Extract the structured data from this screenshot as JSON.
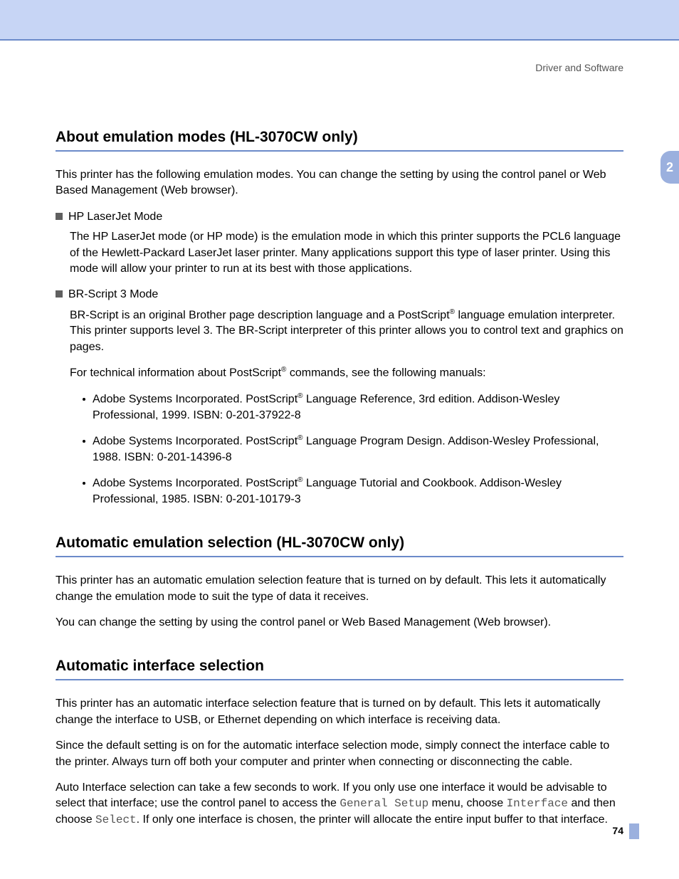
{
  "header": {
    "right_text": "Driver and Software"
  },
  "chapter_tab": "2",
  "page_number": "74",
  "section1": {
    "title": "About emulation modes (HL-3070CW only)",
    "sub": "2",
    "intro": "This printer has the following emulation modes. You can change the setting by using the control panel or Web Based Management (Web browser).",
    "mode1_title": "HP LaserJet Mode",
    "mode1_body": "The HP LaserJet mode (or HP mode) is the emulation mode in which this printer supports the PCL6 language of the Hewlett-Packard LaserJet laser printer. Many applications support this type of laser printer. Using this mode will allow your printer to run at its best with those applications.",
    "mode2_title": "BR-Script 3 Mode",
    "mode2_body_a": "BR-Script is an original Brother page description language and a PostScript",
    "mode2_body_b": " language emulation interpreter. This printer supports level 3. The BR-Script interpreter of this printer allows you to control text and graphics on pages.",
    "mode2_tech_a": "For technical information about PostScript",
    "mode2_tech_b": " commands, see the following manuals:",
    "refs": [
      {
        "a": "Adobe Systems Incorporated. PostScript",
        "b": " Language Reference, 3rd edition. Addison-Wesley Professional, 1999. ISBN: 0-201-37922-8"
      },
      {
        "a": "Adobe Systems Incorporated. PostScript",
        "b": " Language Program Design. Addison-Wesley Professional, 1988. ISBN: 0-201-14396-8"
      },
      {
        "a": "Adobe Systems Incorporated. PostScript",
        "b": " Language Tutorial and Cookbook. Addison-Wesley Professional, 1985. ISBN: 0-201-10179-3"
      }
    ]
  },
  "section2": {
    "title": "Automatic emulation selection (HL-3070CW only)",
    "sub": "2",
    "p1": "This printer has an automatic emulation selection feature that is turned on by default. This lets it automatically change the emulation mode to suit the type of data it receives.",
    "p2": "You can change the setting by using the control panel or Web Based Management (Web browser)."
  },
  "section3": {
    "title": "Automatic interface selection",
    "sub": "2",
    "p1": "This printer has an automatic interface selection feature that is turned on by default. This lets it automatically change the interface to USB, or Ethernet depending on which interface is receiving data.",
    "p2": "Since the default setting is on for the automatic interface selection mode, simply connect the interface cable to the printer. Always turn off both your computer and printer when connecting or disconnecting the cable.",
    "p3_a": "Auto Interface selection can take a few seconds to work. If you only use one interface it would be advisable to select that interface; use the control panel to access the ",
    "p3_m1": "General Setup",
    "p3_b": " menu, choose ",
    "p3_m2": "Interface",
    "p3_c": " and then choose ",
    "p3_m3": "Select",
    "p3_d": ". If only one interface is chosen, the printer will allocate the entire input buffer to that interface."
  }
}
